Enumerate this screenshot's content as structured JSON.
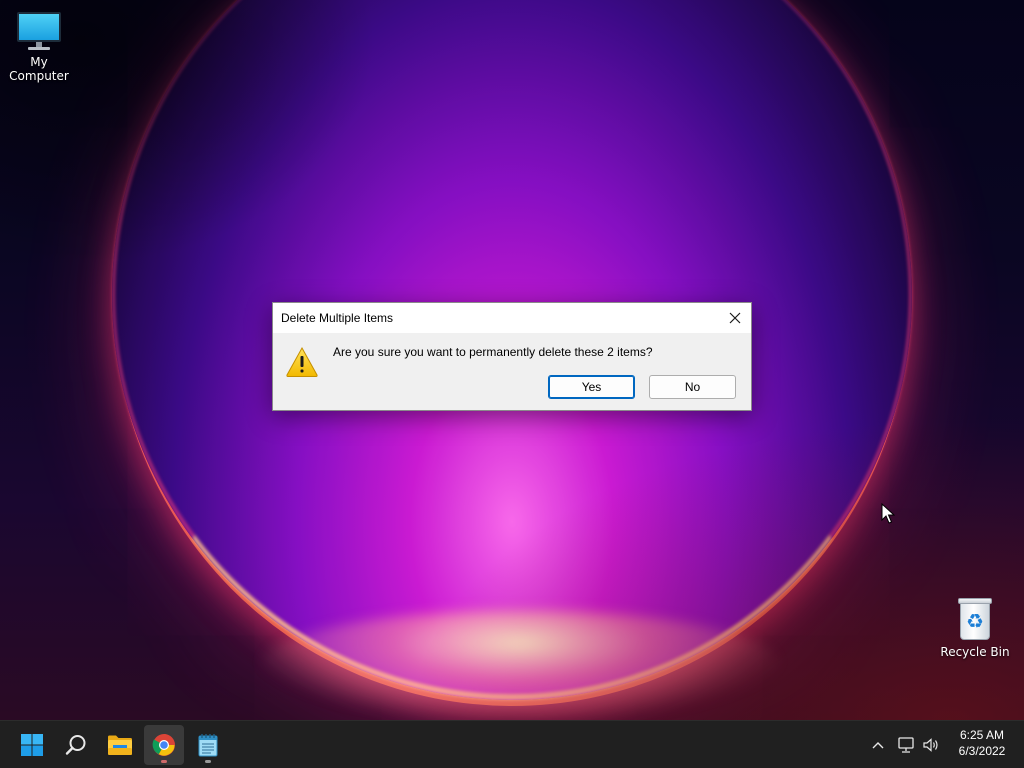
{
  "desktop": {
    "icons": [
      {
        "label": "My Computer",
        "icon": "monitor-icon"
      },
      {
        "label": "Recycle Bin",
        "icon": "recycle-bin-icon"
      }
    ]
  },
  "dialog": {
    "title": "Delete Multiple Items",
    "message": "Are you sure you want to permanently delete these 2 items?",
    "icon": "warning-icon",
    "buttons": {
      "yes": "Yes",
      "no": "No"
    },
    "default_button": "yes",
    "accent_color": "#0067c0"
  },
  "taskbar": {
    "apps": [
      {
        "name": "start",
        "icon": "windows-logo-icon"
      },
      {
        "name": "search",
        "icon": "search-icon"
      },
      {
        "name": "file-explorer",
        "icon": "folder-icon"
      },
      {
        "name": "chrome",
        "icon": "chrome-icon",
        "active": true
      },
      {
        "name": "notepad",
        "icon": "notepad-icon"
      }
    ],
    "tray": {
      "icons": [
        "chevron-up-icon",
        "network-icon",
        "volume-icon"
      ]
    },
    "clock": {
      "time": "6:25 AM",
      "date": "6/3/2022"
    }
  }
}
